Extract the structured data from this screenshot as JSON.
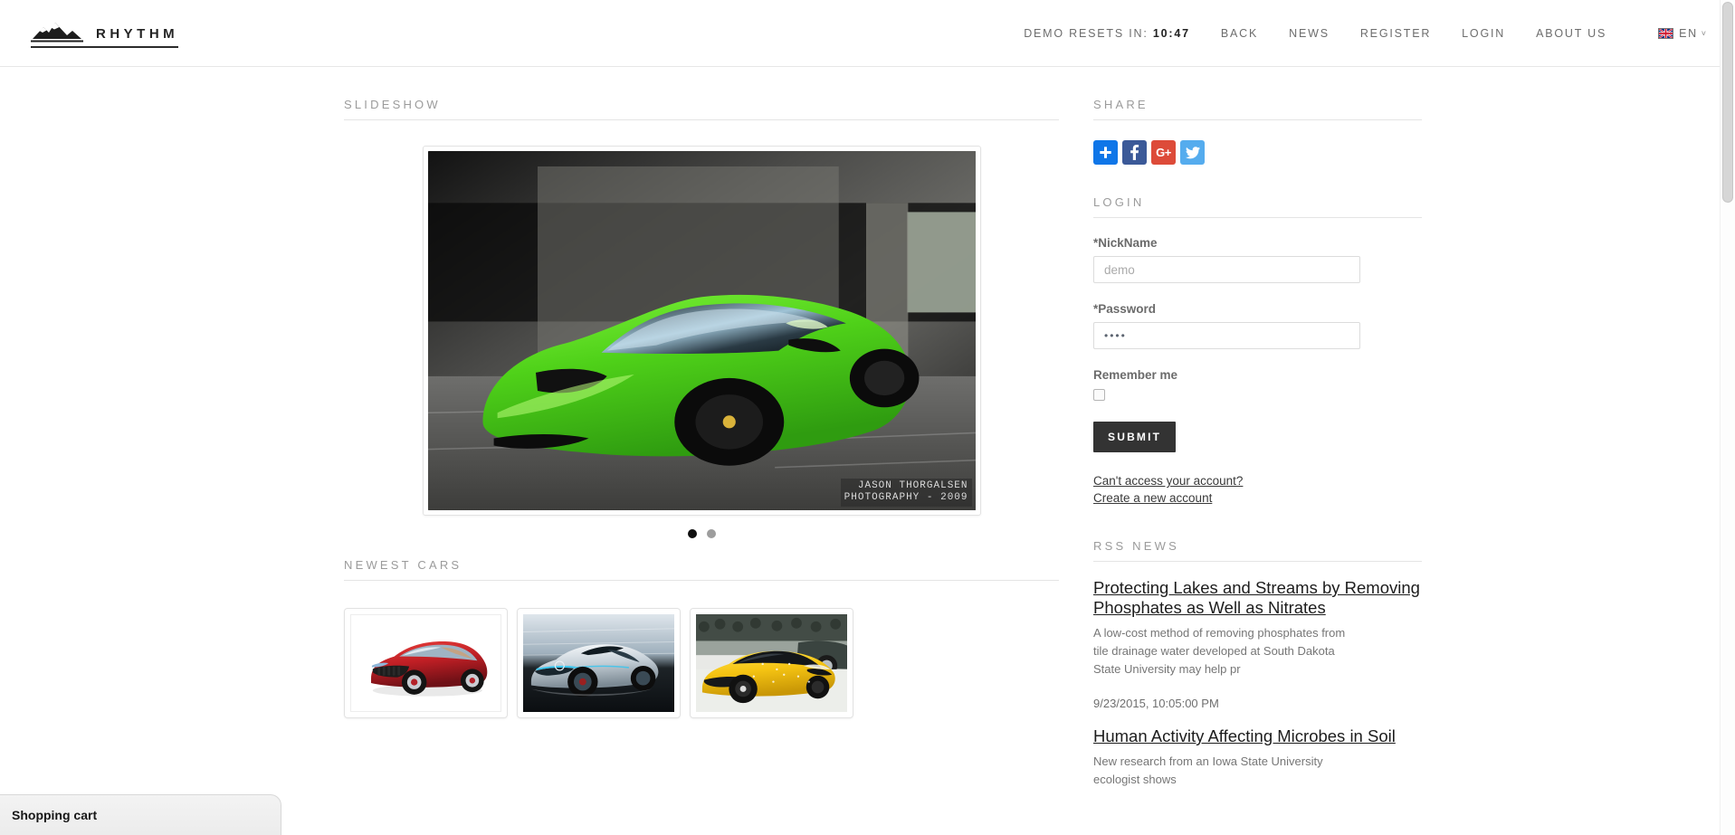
{
  "header": {
    "brand_name": "RHYTHM",
    "brand_icon": "mountain-icon",
    "demo_prefix": "DEMO RESETS IN:",
    "demo_timer": "10:47",
    "nav": [
      {
        "label": "BACK"
      },
      {
        "label": "NEWS"
      },
      {
        "label": "REGISTER"
      },
      {
        "label": "LOGIN"
      },
      {
        "label": "ABOUT US"
      }
    ],
    "language": {
      "label": "EN",
      "flag": "uk-flag-icon",
      "chevron": "˅"
    }
  },
  "main": {
    "slideshow": {
      "title": "SLIDESHOW",
      "slide_alt": "Green Lamborghini Gallardo driving through a tunnel",
      "watermark_line1": "JASON THORGALSEN",
      "watermark_line2": "PHOTOGRAPHY - 2009",
      "dots": [
        {
          "active": true
        },
        {
          "active": false
        }
      ]
    },
    "newest_cars": {
      "title": "NEWEST CARS",
      "items": [
        {
          "alt": "Red sports sedan on white background"
        },
        {
          "alt": "Silver concept roadster rendering"
        },
        {
          "alt": "Yellow Lamborghini Huracan at auto show"
        }
      ]
    }
  },
  "sidebar": {
    "share": {
      "title": "SHARE",
      "buttons": [
        {
          "name": "addthis",
          "glyph": "✚",
          "color": "#0f76e8"
        },
        {
          "name": "facebook",
          "glyph": "f",
          "color": "#3b5998"
        },
        {
          "name": "google-plus",
          "glyph": "G+",
          "color": "#dd4b39"
        },
        {
          "name": "twitter",
          "glyph": "🐦",
          "color": "#55acee"
        }
      ]
    },
    "login": {
      "title": "LOGIN",
      "nickname_label": "*NickName",
      "nickname_value": "demo",
      "nickname_placeholder": "demo",
      "password_label": "*Password",
      "password_value": "••••",
      "remember_label": "Remember me",
      "remember_checked": false,
      "submit_label": "SUBMIT",
      "forgot_link": "Can't access your account?",
      "create_link": "Create a new account"
    },
    "rss": {
      "title": "RSS NEWS",
      "items": [
        {
          "title": "Protecting Lakes and Streams by Removing Phosphates as Well as Nitrates",
          "description": "A low-cost method of removing phosphates from tile drainage water developed at South Dakota State University may help pr",
          "date": "9/23/2015, 10:05:00 PM"
        },
        {
          "title": "Human Activity Affecting Microbes in Soil",
          "description": "New research from an Iowa State University ecologist shows",
          "date": ""
        }
      ]
    }
  },
  "cart": {
    "label": "Shopping cart"
  },
  "colors": {
    "accent_dark": "#333333",
    "text_muted": "#9b9b9b",
    "border": "#e4e4e4"
  }
}
